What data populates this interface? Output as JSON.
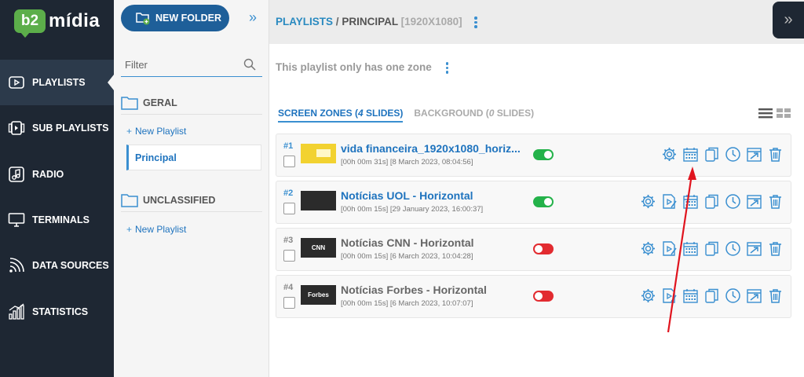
{
  "logo": {
    "badge": "b2",
    "text": "mídia"
  },
  "nav": [
    {
      "label": "PLAYLISTS",
      "icon": "play-icon",
      "active": true
    },
    {
      "label": "SUB PLAYLISTS",
      "icon": "sub-playlist-icon"
    },
    {
      "label": "RADIO",
      "icon": "music-icon"
    },
    {
      "label": "TERMINALS",
      "icon": "monitor-icon"
    },
    {
      "label": "DATA SOURCES",
      "icon": "signal-icon"
    },
    {
      "label": "STATISTICS",
      "icon": "bar-chart-icon"
    }
  ],
  "folders": {
    "new_folder_label": "NEW FOLDER",
    "filter_placeholder": "Filter",
    "groups": [
      {
        "name": "GERAL",
        "new_playlist": "New Playlist",
        "items": [
          "Principal"
        ]
      },
      {
        "name": "UNCLASSIFIED",
        "new_playlist": "New Playlist",
        "items": []
      }
    ]
  },
  "header": {
    "breadcrumb_root": "PLAYLISTS",
    "breadcrumb_sep": "/",
    "breadcrumb_current": "PRINCIPAL",
    "resolution": "[1920X1080]"
  },
  "zone_note": "This playlist only has one zone",
  "tabs": [
    {
      "prefix": "SCREEN ZONES (",
      "count": "4",
      "suffix": " SLIDES)",
      "active": true
    },
    {
      "prefix": "BACKGROUND (",
      "count": "0",
      "suffix": " SLIDES)",
      "active": false
    }
  ],
  "slides": [
    {
      "num": "#1",
      "title": "vida financeira_1920x1080_horiz...",
      "meta": "[00h 00m 31s] [8 March 2023, 08:04:56]",
      "enabled": true,
      "thumb": "yellow",
      "thumb_text": "",
      "has_edit": false
    },
    {
      "num": "#2",
      "title": "Notícias UOL - Horizontal",
      "meta": "[00h 00m 15s] [29 January 2023, 16:00:37]",
      "enabled": true,
      "thumb": "dark",
      "thumb_text": "",
      "has_edit": true
    },
    {
      "num": "#3",
      "title": "Notícias CNN - Horizontal",
      "meta": "[00h 00m 15s] [6 March 2023, 10:04:28]",
      "enabled": false,
      "thumb": "dark",
      "thumb_text": "CNN",
      "has_edit": true
    },
    {
      "num": "#4",
      "title": "Notícias Forbes - Horizontal",
      "meta": "[00h 00m 15s] [6 March 2023, 10:07:07]",
      "enabled": false,
      "thumb": "dark",
      "thumb_text": "Forbes",
      "has_edit": true
    }
  ],
  "colors": {
    "sidebar": "#1e2733",
    "accent": "#3a8fd0",
    "link": "#1e73be",
    "toggle_on": "#24b24a",
    "toggle_off": "#e22b30",
    "annotation_arrow": "#e0141e"
  }
}
